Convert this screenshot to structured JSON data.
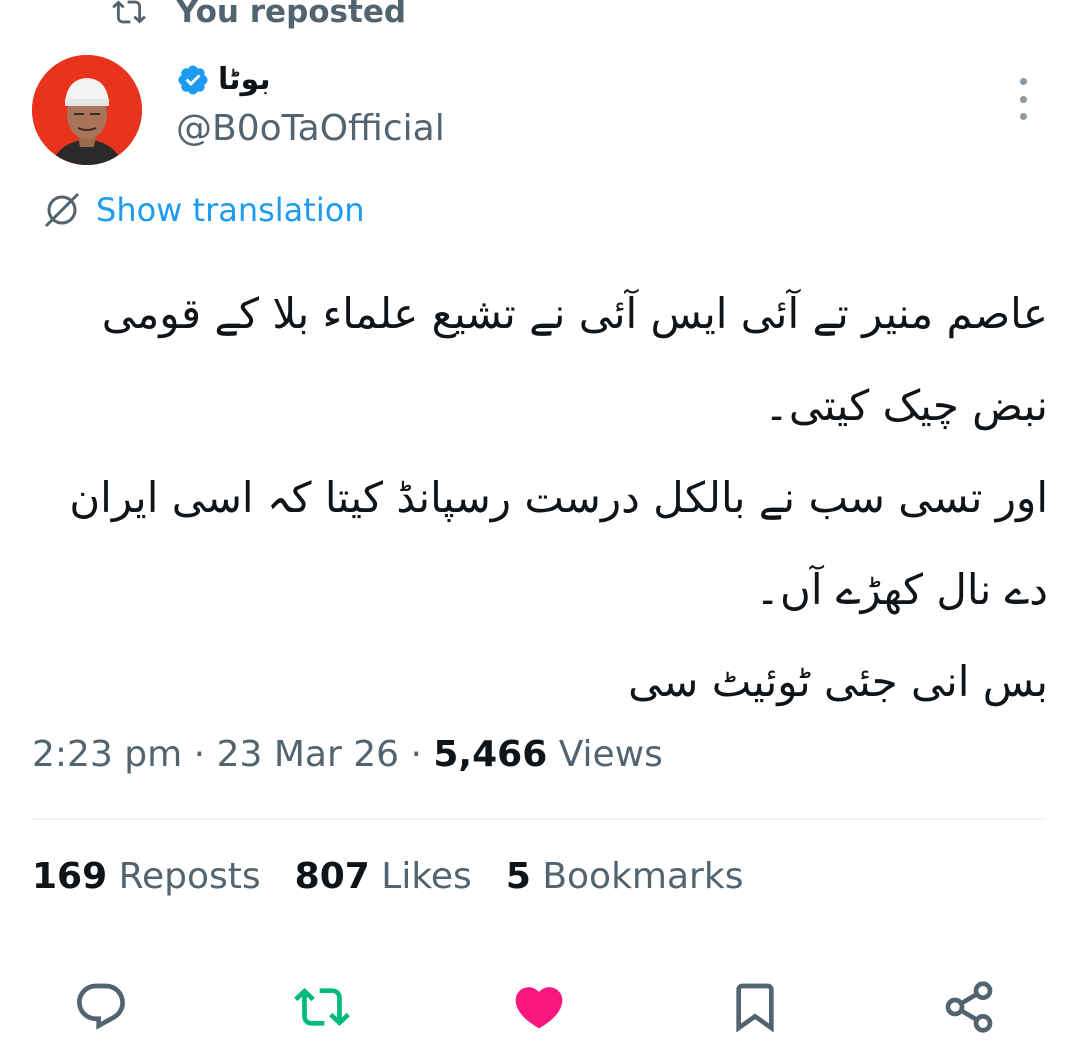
{
  "repost_banner": {
    "text": "You reposted"
  },
  "author": {
    "display_name": "بوٹا",
    "handle": "@B0oTaOfficial",
    "verified": true
  },
  "translation": {
    "label": "Show translation"
  },
  "tweet": {
    "lines": [
      "عاصم منیر تے آئی ایس آئی نے تشیع علماء بلا کے قومی نبض چیک کیتی۔",
      "اور تسی سب نے بالکل درست رسپانڈ کیتا کہ اسی ایران دے نال کھڑے آں۔",
      "بس انی جئی ٹوئیٹ سی"
    ]
  },
  "meta": {
    "time": "2:23 pm",
    "date": "23 Mar 26",
    "views_count": "5,466",
    "views_label": "Views",
    "separator": "·"
  },
  "stats": {
    "reposts_count": "169",
    "reposts_label": "Reposts",
    "likes_count": "807",
    "likes_label": "Likes",
    "bookmarks_count": "5",
    "bookmarks_label": "Bookmarks"
  },
  "actions": {
    "reply": "reply-icon",
    "repost": "repost-icon",
    "like": "heart-icon",
    "bookmark": "bookmark-icon",
    "share": "share-icon"
  },
  "colors": {
    "accent": "#1d9bf0",
    "repost_active": "#00ba7c",
    "like_active": "#f91880",
    "muted": "#536471",
    "avatar_bg": "#e8341c"
  }
}
